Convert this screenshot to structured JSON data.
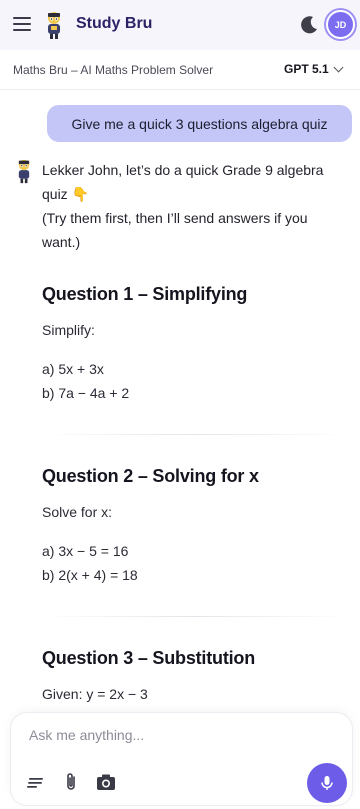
{
  "header": {
    "brand": "Study Bru",
    "avatar_initials": "JD"
  },
  "subheader": {
    "title": "Maths Bru – AI Maths Problem Solver",
    "model": "GPT 5.1"
  },
  "chat": {
    "user_message": "Give me a quick 3 questions algebra quiz",
    "intro_line1": "Lekker John, let’s do a quick Grade 9 algebra quiz",
    "intro_emoji": "👇",
    "intro_line2": "(Try them first, then I’ll send answers if you want.)",
    "questions": [
      {
        "title": "Question 1 – Simplifying",
        "instruction": "Simplify:",
        "items": [
          "a) 5x + 3x",
          "b) 7a − 4a + 2"
        ]
      },
      {
        "title": "Question 2 – Solving for x",
        "instruction": "Solve for x:",
        "items": [
          "a) 3x − 5 = 16",
          "b) 2(x + 4) = 18"
        ]
      },
      {
        "title": "Question 3 – Substitution",
        "instruction": "Given: y = 2x − 3",
        "items": []
      }
    ]
  },
  "composer": {
    "placeholder": "Ask me anything..."
  },
  "colors": {
    "accent": "#6c5ce7",
    "user_bubble": "#c3c6f7",
    "brand_text": "#2b2366"
  },
  "icons": [
    "menu-icon",
    "mascot-logo-icon",
    "moon-icon",
    "chevron-down-icon",
    "prompts-icon",
    "paperclip-icon",
    "camera-icon",
    "microphone-icon"
  ]
}
